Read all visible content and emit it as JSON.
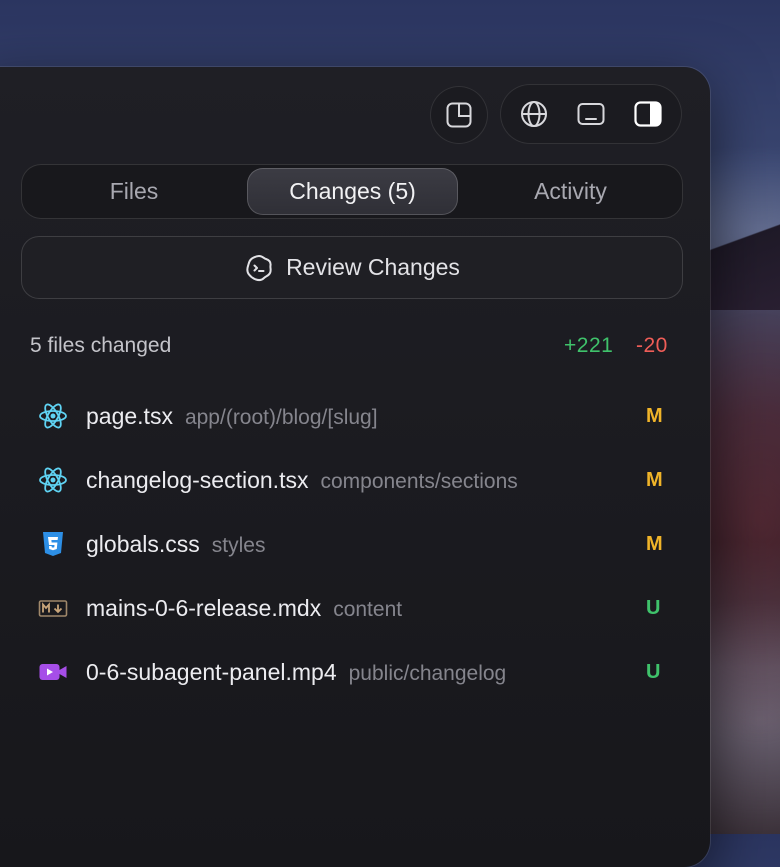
{
  "toolbar": {
    "icons": [
      "window-panel-icon",
      "globe-icon",
      "terminal-icon",
      "sidebar-toggle-icon"
    ]
  },
  "tabs": [
    {
      "label": "Files"
    },
    {
      "label": "Changes (5)"
    },
    {
      "label": "Activity"
    }
  ],
  "review_button": {
    "label": "Review Changes",
    "icon": "review-icon"
  },
  "summary": {
    "text": "5 files changed",
    "additions": "+221",
    "deletions": "-20"
  },
  "files": [
    {
      "name": "page.tsx",
      "path": "app/(root)/blog/[slug]",
      "status": "M",
      "icon": "react-icon"
    },
    {
      "name": "changelog-section.tsx",
      "path": "components/sections",
      "status": "M",
      "icon": "react-icon"
    },
    {
      "name": "globals.css",
      "path": "styles",
      "status": "M",
      "icon": "css-icon"
    },
    {
      "name": "mains-0-6-release.mdx",
      "path": "content",
      "status": "U",
      "icon": "markdown-icon"
    },
    {
      "name": "0-6-subagent-panel.mp4",
      "path": "public/changelog",
      "status": "U",
      "icon": "video-icon"
    }
  ],
  "colors": {
    "modified": "#f0b429",
    "untracked": "#3fc26b",
    "additions": "#3fc26b",
    "deletions": "#ef5d58"
  }
}
